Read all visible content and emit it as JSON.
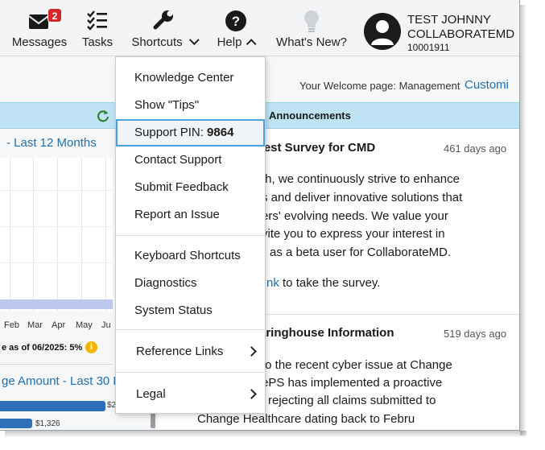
{
  "nav": {
    "messages": {
      "label": "Messages",
      "badge": "2"
    },
    "tasks": {
      "label": "Tasks"
    },
    "shortcuts": {
      "label": "Shortcuts"
    },
    "help": {
      "label": "Help"
    },
    "whats_new": {
      "label": "What's New?"
    }
  },
  "user": {
    "name_line1": "TEST JOHNNY",
    "name_line2": "COLLABORATEMD",
    "id": "10001911"
  },
  "page": {
    "welcome_label": "Your Welcome page: Management",
    "customize_label": "Customi"
  },
  "left_panel": {
    "chart_title": "- Last 12 Months",
    "months": [
      "Feb",
      "Mar",
      "Apr",
      "May",
      "Ju"
    ],
    "coverage_note": "e as of 06/2025: 5%",
    "charge_title": "ge Amount - Last 30 D",
    "bar1_label": "$2",
    "bar2_label": "$1,326"
  },
  "announcements": {
    "title": "Announcements",
    "items": [
      {
        "heading": "rest Survey for CMD",
        "age": "461 days ago",
        "lines": [
          "th, we continuously strive to enhance",
          "s and deliver innovative solutions that",
          "ers' evolving needs. We value your",
          "vite you to express your interest in",
          "as a beta user for CollaborateMD."
        ],
        "link_text": "nk",
        "after_link": " to take the survey."
      },
      {
        "heading": "aringhouse Information",
        "age": "519 days ago",
        "lines": [
          "to the recent cyber issue at Change",
          "ePS has implemented a proactive",
          "rejecting all claims submitted to",
          "Change Healthcare dating back to Febru"
        ]
      }
    ]
  },
  "help_menu": {
    "items": [
      {
        "label": "Knowledge Center"
      },
      {
        "label": "Show \"Tips\""
      },
      {
        "label": "Support PIN: ",
        "pin": "9864"
      },
      {
        "label": "Contact Support"
      },
      {
        "label": "Submit Feedback"
      },
      {
        "label": "Report an Issue"
      },
      {
        "label": "Keyboard Shortcuts"
      },
      {
        "label": "Diagnostics"
      },
      {
        "label": "System Status"
      },
      {
        "label": "Reference Links"
      },
      {
        "label": "Legal"
      }
    ]
  },
  "colors": {
    "accent_blue": "#1f6fb2",
    "badge_red": "#d7262b",
    "header_blue": "#bfe3f4",
    "highlight_border": "#4aa3df"
  }
}
